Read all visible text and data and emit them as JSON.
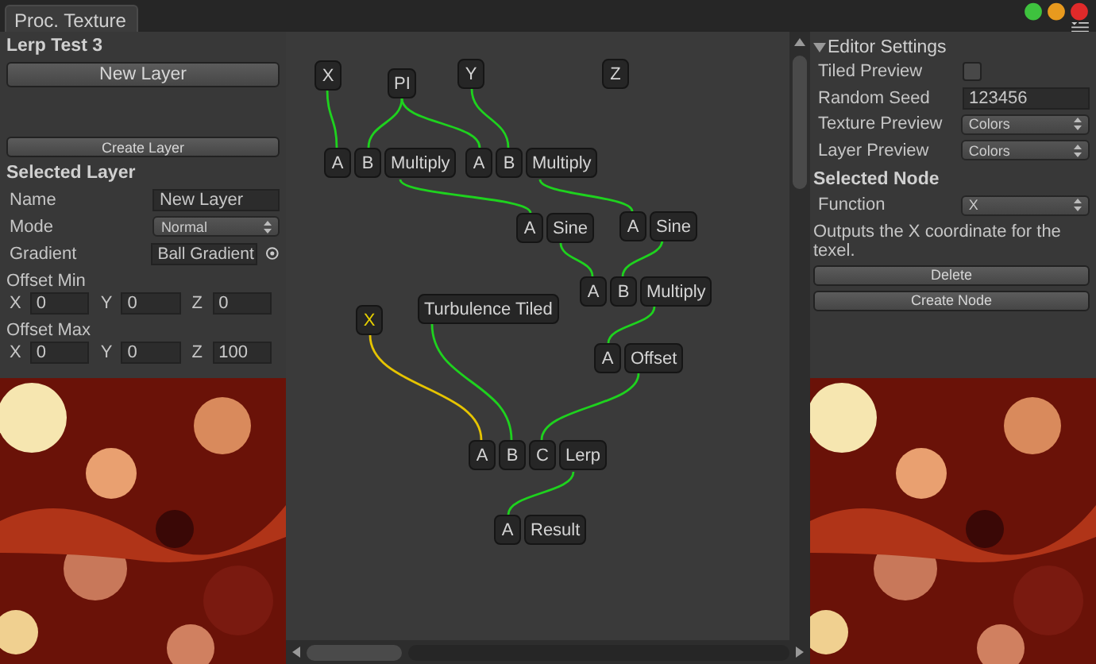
{
  "tab": {
    "label": "Proc. Texture",
    "selected": true
  },
  "left_panel": {
    "title": "Lerp Test 3",
    "new_layer_button": "New Layer",
    "create_layer_button": "Create Layer",
    "section": "Selected Layer",
    "fields": [
      {
        "kind": "text",
        "label": "Name",
        "value": "New Layer"
      },
      {
        "kind": "dropdown",
        "label": "Mode",
        "value": "Normal"
      },
      {
        "kind": "object",
        "label": "Gradient",
        "value": "Ball Gradient"
      }
    ],
    "offsets": [
      {
        "label": "Offset Min",
        "axes": [
          {
            "axis": "X",
            "value": "0"
          },
          {
            "axis": "Y",
            "value": "0"
          },
          {
            "axis": "Z",
            "value": "0"
          }
        ]
      },
      {
        "label": "Offset Max",
        "axes": [
          {
            "axis": "X",
            "value": "0"
          },
          {
            "axis": "Y",
            "value": "0"
          },
          {
            "axis": "Z",
            "value": "100"
          }
        ]
      }
    ],
    "preview": {
      "kind": "picture"
    }
  },
  "graph": {
    "nodes": [
      {
        "label": "X",
        "selected": false
      },
      {
        "label": "PI",
        "selected": false
      },
      {
        "label": "Y",
        "selected": false
      },
      {
        "label": "Z",
        "selected": false
      },
      {
        "label": "Multiply",
        "inputs": [
          "A",
          "B"
        ],
        "selected": false
      },
      {
        "label": "Multiply",
        "inputs": [
          "A",
          "B"
        ],
        "selected": false
      },
      {
        "label": "Sine",
        "inputs": [
          "A"
        ],
        "selected": false
      },
      {
        "label": "Sine",
        "inputs": [
          "A"
        ],
        "selected": false
      },
      {
        "label": "Multiply",
        "inputs": [
          "A",
          "B"
        ],
        "selected": false
      },
      {
        "label": "X",
        "selected": true
      },
      {
        "label": "Turbulence Tiled",
        "selected": false
      },
      {
        "label": "Offset",
        "inputs": [
          "A"
        ],
        "selected": false
      },
      {
        "label": "Lerp",
        "inputs": [
          "A",
          "B",
          "C"
        ],
        "selected": false
      },
      {
        "label": "Result",
        "inputs": [
          "A"
        ],
        "selected": false
      }
    ]
  },
  "right_panel": {
    "section": "Editor Settings",
    "expanded": true,
    "settings": [
      {
        "kind": "checkbox",
        "label": "Tiled Preview",
        "checked": false
      },
      {
        "kind": "text",
        "label": "Random Seed",
        "value": "123456"
      },
      {
        "kind": "dropdown",
        "label": "Texture Preview",
        "value": "Colors"
      },
      {
        "kind": "dropdown",
        "label": "Layer Preview",
        "value": "Colors"
      }
    ],
    "node_section": "Selected Node",
    "node_fields": [
      {
        "kind": "dropdown",
        "label": "Function",
        "value": "X"
      }
    ],
    "description": "Outputs the X coordinate for the texel.",
    "buttons": [
      "Delete",
      "Create Node"
    ],
    "preview": {
      "kind": "picture"
    }
  }
}
